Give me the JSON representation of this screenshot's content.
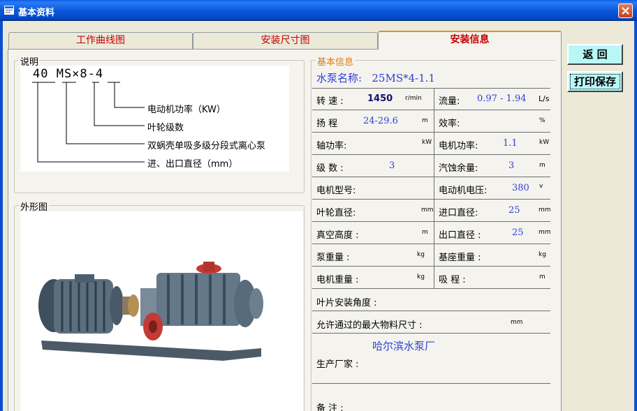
{
  "window": {
    "title": "基本资料"
  },
  "tabs": [
    {
      "label": "工作曲线图",
      "active": false
    },
    {
      "label": "安装尺寸图",
      "active": false
    },
    {
      "label": "安装信息",
      "active": true
    }
  ],
  "buttons": {
    "back": "返  回",
    "print_save": "打印保存"
  },
  "description": {
    "legend": "说明",
    "model_code": "40 MS×8-4",
    "lines": [
      "电动机功率（KW）",
      "叶轮级数",
      "双蜗壳单吸多级分段式离心泵",
      "进、出口直径（mm）"
    ]
  },
  "photo": {
    "legend": "外形图",
    "image": "multistage-centrifugal-pump-photo"
  },
  "basic_info": {
    "legend": "基本信息",
    "pump_name_label": "水泵名称:",
    "pump_name_value": "25MS*4-1.1",
    "rows": [
      {
        "label": "转 速 :",
        "value": "1450",
        "unit": "r/min",
        "label2": "流量:",
        "value2": "0.97 - 1.94",
        "unit2": "L/s"
      },
      {
        "label": "扬 程",
        "value": "24-29.6",
        "unit": "m",
        "label2": "效率:",
        "value2": "",
        "unit2": "%"
      },
      {
        "label": "轴功率:",
        "value": "",
        "unit": "kW",
        "label2": "电机功率:",
        "value2": "1.1",
        "unit2": "kW"
      },
      {
        "label": "级 数 :",
        "value": "3",
        "unit": "",
        "label2": "汽蚀余量:",
        "value2": "3",
        "unit2": "m"
      },
      {
        "label": "电机型号:",
        "value": "",
        "unit": "",
        "label2": "电动机电压:",
        "value2": "380",
        "unit2": "v"
      },
      {
        "label": "叶轮直径:",
        "value": "",
        "unit": "mm",
        "label2": "进口直径:",
        "value2": "25",
        "unit2": "mm"
      },
      {
        "label": "真空高度 :",
        "value": "",
        "unit": "m",
        "label2": "出口直径 :",
        "value2": "25",
        "unit2": "mm"
      },
      {
        "label": "泵重量 :",
        "value": "",
        "unit": "kg",
        "label2": "基座重量 :",
        "value2": "",
        "unit2": "kg"
      },
      {
        "label": "电机重量 :",
        "value": "",
        "unit": "kg",
        "label2": "吸 程 :",
        "value2": "",
        "unit2": "m"
      }
    ],
    "blade_angle_label": "叶片安装角度 :",
    "max_size_label": "允许通过的最大物料尺寸 :",
    "max_size_unit": "mm",
    "manufacturer_label": "生产厂家 :",
    "manufacturer_value": "哈尔滨水泵厂",
    "remarks_label": "备  注 :"
  },
  "colors": {
    "titlebar": "#0b59dd",
    "tab_text": "#c40000",
    "value_blue": "#2d3fd8",
    "legend_orange": "#e3780a",
    "button_cyan": "#b9f7f7"
  }
}
